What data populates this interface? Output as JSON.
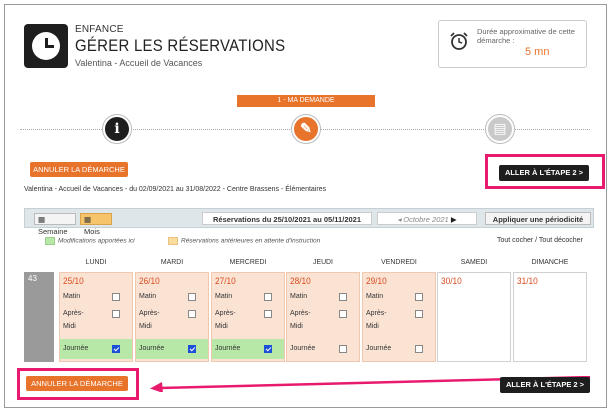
{
  "header": {
    "category": "ENFANCE",
    "title": "GÉRER LES RÉSERVATIONS",
    "subtitle": "Valentina - Accueil de Vacances",
    "duration_label": "Durée approximative de cette démarche :",
    "duration_value": "5 mn"
  },
  "stepper": {
    "current_label": "1 - MA DEMANDE",
    "steps": [
      {
        "icon": "info-icon",
        "glyph": "i"
      },
      {
        "icon": "pencil-icon",
        "glyph": "✎"
      },
      {
        "icon": "document-icon",
        "glyph": "▤"
      }
    ]
  },
  "actions": {
    "cancel_label": "ANNULER LA DÉMARCHE",
    "next_label": "ALLER À L'ÉTAPE 2 >"
  },
  "context_line": "Valentina - Accueil de Vacances - du 02/09/2021 au 31/08/2022 - Centre Brassens - Élémentaires",
  "toolbar": {
    "week_label": "Semaine",
    "month_label": "Mois",
    "range_label": "Réservations du 25/10/2021 au 05/11/2021",
    "month_nav": "Octobre 2021",
    "period_label": "Appliquer une périodicité"
  },
  "legend": {
    "modified": "Modifications apportées ici",
    "pending": "Réservations antérieures en attente d'instruction",
    "modified_color": "#b8e8a8",
    "pending_color": "#fbdc9e"
  },
  "check_links": {
    "check_all": "Tout cocher",
    "separator": "/",
    "uncheck_all": "Tout décocher"
  },
  "calendar": {
    "week_number": "43",
    "days": [
      "LUNDI",
      "MARDI",
      "MERCREDI",
      "JEUDI",
      "VENDREDI",
      "SAMEDI",
      "DIMANCHE"
    ],
    "slot_labels": {
      "matin": "Matin",
      "apres": "Après-",
      "midi": "Midi",
      "journee": "Journée"
    },
    "cells": [
      {
        "date": "25/10",
        "bookable": true,
        "journee": true
      },
      {
        "date": "26/10",
        "bookable": true,
        "journee": true
      },
      {
        "date": "27/10",
        "bookable": true,
        "journee": true
      },
      {
        "date": "28/10",
        "bookable": true,
        "journee": false
      },
      {
        "date": "29/10",
        "bookable": true,
        "journee": false
      },
      {
        "date": "30/10",
        "bookable": false
      },
      {
        "date": "31/10",
        "bookable": false
      }
    ]
  },
  "colors": {
    "accent": "#e8742c",
    "highlight": "#e81a6e",
    "dark": "#1e1e1e"
  }
}
